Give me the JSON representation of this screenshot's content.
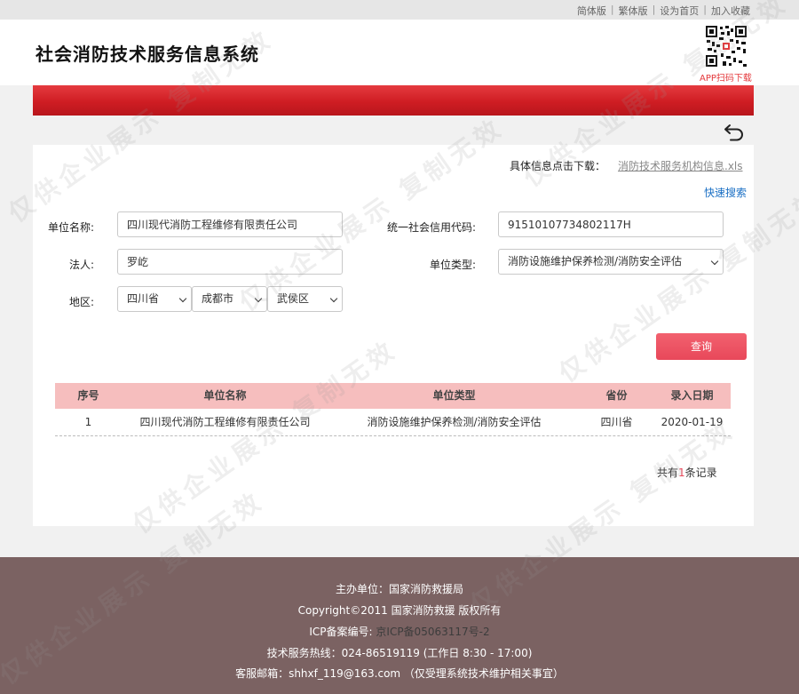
{
  "topbar": {
    "links": [
      "简体版",
      "繁体版",
      "设为首页",
      "加入收藏"
    ]
  },
  "header": {
    "title": "社会消防技术服务信息系统",
    "qr_caption": "APP扫码下载"
  },
  "download": {
    "label": "具体信息点击下载：",
    "file": "消防技术服务机构信息.xls"
  },
  "quick_search": "快速搜索",
  "form": {
    "unit_name_label": "单位名称:",
    "unit_name_value": "四川现代消防工程维修有限责任公司",
    "credit_code_label": "统一社会信用代码:",
    "credit_code_value": "91510107734802117H",
    "legal_label": "法人:",
    "legal_value": "罗屹",
    "unit_type_label": "单位类型:",
    "unit_type_value": "消防设施维护保养检测/消防安全评估",
    "region_label": "地区:",
    "province": "四川省",
    "city": "成都市",
    "district": "武侯区",
    "query_button": "查询"
  },
  "table": {
    "headers": [
      "序号",
      "单位名称",
      "单位类型",
      "省份",
      "录入日期"
    ],
    "rows": [
      [
        "1",
        "四川现代消防工程维修有限责任公司",
        "消防设施维护保养检测/消防安全评估",
        "四川省",
        "2020-01-19"
      ]
    ]
  },
  "total": {
    "prefix": "共有",
    "count": "1",
    "suffix": "条记录"
  },
  "footer": {
    "host": "主办单位：国家消防救援局",
    "copyright": "Copyright©2011 国家消防救援 版权所有",
    "icp_label": "ICP备案编号: ",
    "icp_value": "京ICP备05063117号-2",
    "hotline": "技术服务热线：024-86519119 (工作日 8:30 - 17:00)",
    "email": "客服邮箱：shhxf_119@163.com （仅受理系统技术维护相关事宜）"
  },
  "watermark": "仅供企业展示  复制无效",
  "colors": {
    "brand_red": "#cf1d23",
    "table_header_bg": "#f6bebe",
    "query_button": "#e8485a",
    "link_blue": "#1a6fc4",
    "footer_bg": "#7b6262"
  }
}
